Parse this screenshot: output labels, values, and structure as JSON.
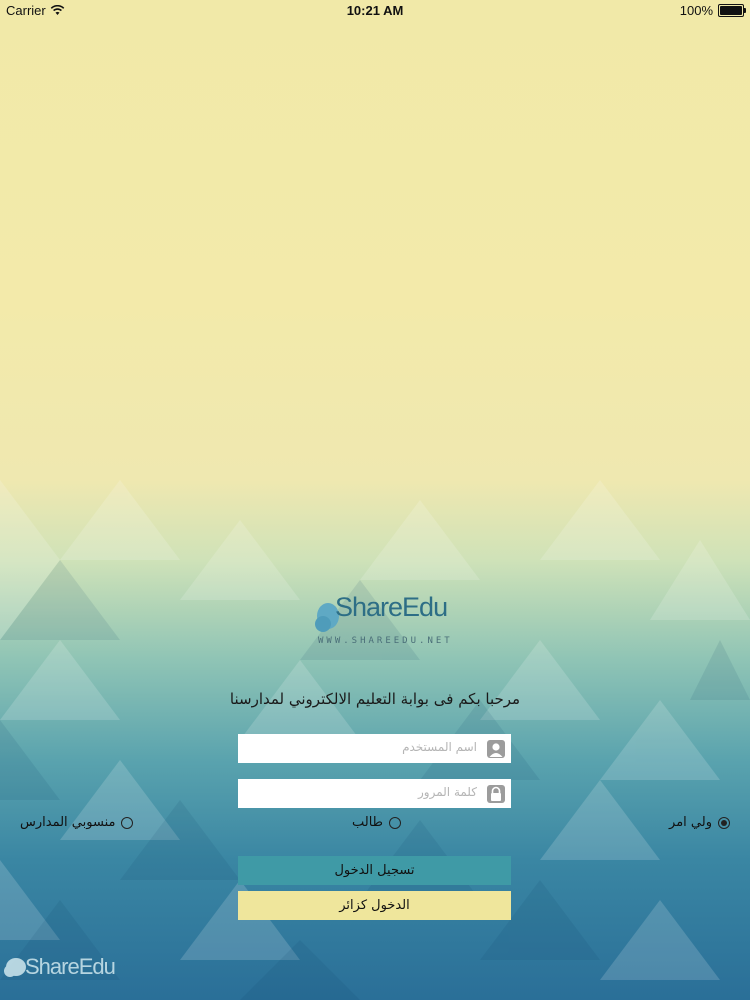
{
  "status_bar": {
    "carrier": "Carrier",
    "time": "10:21 AM",
    "battery": "100%"
  },
  "logo": {
    "name": "ShareEdu",
    "url": "WWW.SHAREEDU.NET"
  },
  "welcome_text": "مرحبا بكم فى بوابة التعليم الالكتروني لمدارسنا",
  "username": {
    "placeholder": "اسم المستخدم",
    "value": ""
  },
  "password": {
    "placeholder": "كلمة المرور",
    "value": ""
  },
  "roles": [
    {
      "label": "ولي امر",
      "selected": true
    },
    {
      "label": "طالب",
      "selected": false
    },
    {
      "label": "منسوبي المدارس",
      "selected": false
    }
  ],
  "buttons": {
    "login": "تسجيل الدخول",
    "visitor": "الدخول كزائر"
  },
  "corner_logo": {
    "name": "ShareEdu"
  },
  "colors": {
    "login_button": "#3f9aa6",
    "visitor_button": "#efe69c",
    "logo_text": "#2d6e86"
  }
}
